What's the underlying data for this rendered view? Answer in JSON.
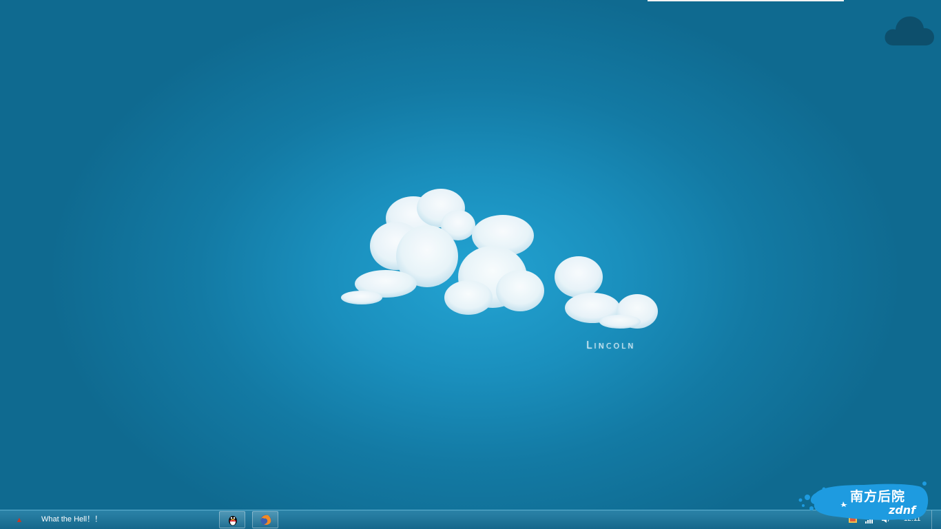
{
  "wallpaper": {
    "caption": "Lincoln"
  },
  "taskbar": {
    "active_window_title": "What the Hell！！",
    "buttons": [
      {
        "name": "qq",
        "icon": "qq-penguin-icon"
      },
      {
        "name": "firefox",
        "icon": "firefox-icon"
      }
    ],
    "tray": {
      "icons": [
        "qq-tray-icon",
        "network-signal-icon",
        "volume-icon"
      ],
      "clock": "12:11"
    }
  },
  "watermark": {
    "title": "南方后院",
    "subtitle": "zdnf"
  },
  "colors": {
    "desktop_center": "#23a3d2",
    "desktop_edge": "#0f6a90",
    "taskbar": "#16678b",
    "cloud_widget": "#0d4f6c",
    "watermark": "#1e9be0"
  }
}
